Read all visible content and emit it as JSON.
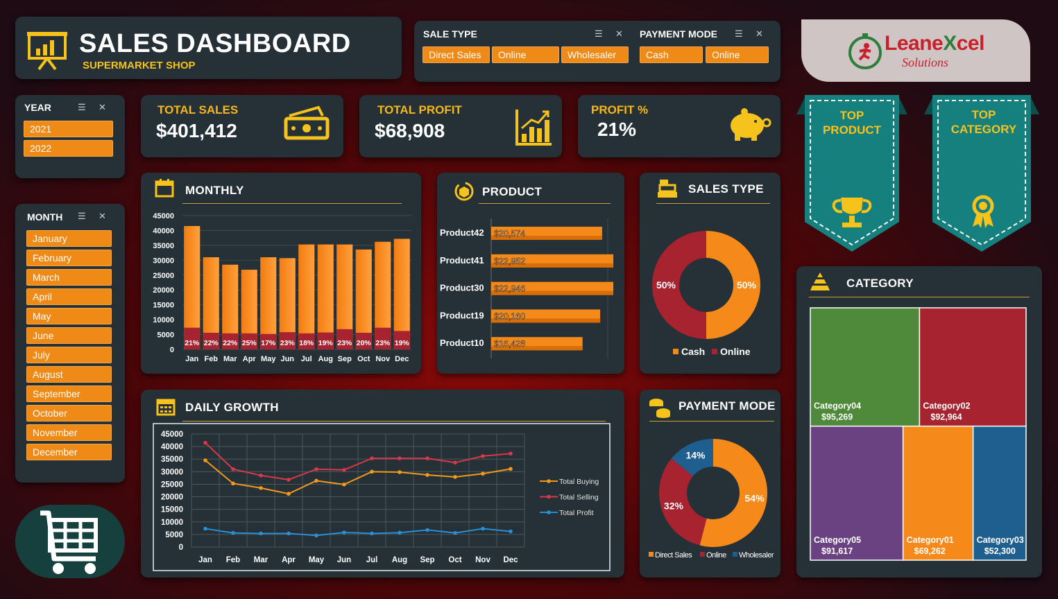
{
  "title": {
    "main": "SALES DASHBOARD",
    "sub": "SUPERMARKET SHOP"
  },
  "filters": {
    "sale_type": {
      "label": "SALE TYPE",
      "options": [
        "Direct Sales",
        "Online",
        "Wholesaler"
      ]
    },
    "payment_mode": {
      "label": "PAYMENT MODE",
      "options": [
        "Cash",
        "Online"
      ]
    },
    "year": {
      "label": "YEAR",
      "options": [
        "2021",
        "2022"
      ]
    },
    "month": {
      "label": "MONTH",
      "options": [
        "January",
        "February",
        "March",
        "April",
        "May",
        "June",
        "July",
        "August",
        "September",
        "October",
        "November",
        "December"
      ]
    }
  },
  "logo": {
    "line1": "LeaneXcel",
    "line2": "Solutions"
  },
  "kpis": {
    "total_sales": {
      "label": "TOTAL SALES",
      "value": "$401,412"
    },
    "total_profit": {
      "label": "TOTAL PROFIT",
      "value": "$68,908"
    },
    "profit_pct": {
      "label": "PROFIT %",
      "value": "21%"
    }
  },
  "ribbons": {
    "top_product": "TOP PRODUCT",
    "top_category": "TOP CATEGORY"
  },
  "section_titles": {
    "monthly": "MONTHLY",
    "product": "PRODUCT",
    "sales_type": "SALES TYPE",
    "daily": "DAILY GROWTH",
    "payment": "PAYMENT MODE",
    "category": "CATEGORY"
  },
  "colors": {
    "orange": "#f58a1b",
    "red": "#a6232f",
    "blue": "#1f5f90",
    "green": "#4f8a3a",
    "purple": "#6a4282",
    "gold": "#f6c21c",
    "teal": "#16807e"
  },
  "chart_data": [
    {
      "id": "monthly",
      "type": "bar",
      "categories": [
        "Jan",
        "Feb",
        "Mar",
        "Apr",
        "May",
        "Jun",
        "Jul",
        "Aug",
        "Sep",
        "Oct",
        "Nov",
        "Dec"
      ],
      "series": [
        {
          "name": "Sales",
          "values": [
            41500,
            31000,
            28500,
            26800,
            31000,
            30700,
            35300,
            35300,
            35300,
            33600,
            36200,
            37200
          ]
        },
        {
          "name": "Profit",
          "values": [
            7300,
            5600,
            5400,
            5400,
            5200,
            5800,
            5400,
            5700,
            6800,
            5600,
            7300,
            6200
          ]
        }
      ],
      "data_labels": [
        "21%",
        "22%",
        "22%",
        "25%",
        "17%",
        "23%",
        "18%",
        "19%",
        "23%",
        "20%",
        "23%",
        "19%"
      ],
      "ylim": [
        0,
        45000
      ],
      "yticks": [
        0,
        5000,
        10000,
        15000,
        20000,
        25000,
        30000,
        35000,
        40000,
        45000
      ]
    },
    {
      "id": "product",
      "type": "bar",
      "orientation": "horizontal",
      "categories": [
        "Product42",
        "Product41",
        "Product30",
        "Product19",
        "Product10"
      ],
      "values": [
        20574,
        22952,
        22946,
        20160,
        16428
      ],
      "labels": [
        "$20,574",
        "$22,952",
        "$22,946",
        "$20,160",
        "$16,428"
      ]
    },
    {
      "id": "sales_type",
      "type": "pie",
      "donut": true,
      "categories": [
        "Cash",
        "Online"
      ],
      "values": [
        50,
        50
      ],
      "labels": [
        "50%",
        "50%"
      ],
      "legend": "bottom"
    },
    {
      "id": "daily_growth",
      "type": "line",
      "categories": [
        "Jan",
        "Feb",
        "Mar",
        "Apr",
        "May",
        "Jun",
        "Jul",
        "Aug",
        "Sep",
        "Oct",
        "Nov",
        "Dec"
      ],
      "series": [
        {
          "name": "Total Buying",
          "values": [
            34500,
            25300,
            23500,
            21200,
            26400,
            24900,
            30000,
            29800,
            28700,
            27900,
            29200,
            31100
          ]
        },
        {
          "name": "Total Selling",
          "values": [
            41500,
            31000,
            28500,
            26800,
            31000,
            30700,
            35300,
            35300,
            35300,
            33600,
            36200,
            37200
          ]
        },
        {
          "name": "Total Profit",
          "values": [
            7300,
            5600,
            5400,
            5400,
            4600,
            5800,
            5400,
            5700,
            6800,
            5600,
            7300,
            6200
          ]
        }
      ],
      "ylim": [
        0,
        45000
      ],
      "yticks": [
        0,
        5000,
        10000,
        15000,
        20000,
        25000,
        30000,
        35000,
        40000,
        45000
      ],
      "grid": true,
      "legend": "right"
    },
    {
      "id": "payment_mode",
      "type": "pie",
      "donut": true,
      "categories": [
        "Direct Sales",
        "Online",
        "Wholesaler"
      ],
      "values": [
        54,
        32,
        14
      ],
      "labels": [
        "54%",
        "32%",
        "14%"
      ],
      "legend": "bottom"
    },
    {
      "id": "category",
      "type": "treemap",
      "categories": [
        "Category04",
        "Category02",
        "Category05",
        "Category01",
        "Category03"
      ],
      "values": [
        95269,
        92964,
        91617,
        69262,
        52300
      ],
      "labels": [
        "$95,269",
        "$92,964",
        "$91,617",
        "$69,262",
        "$52,300"
      ]
    }
  ]
}
